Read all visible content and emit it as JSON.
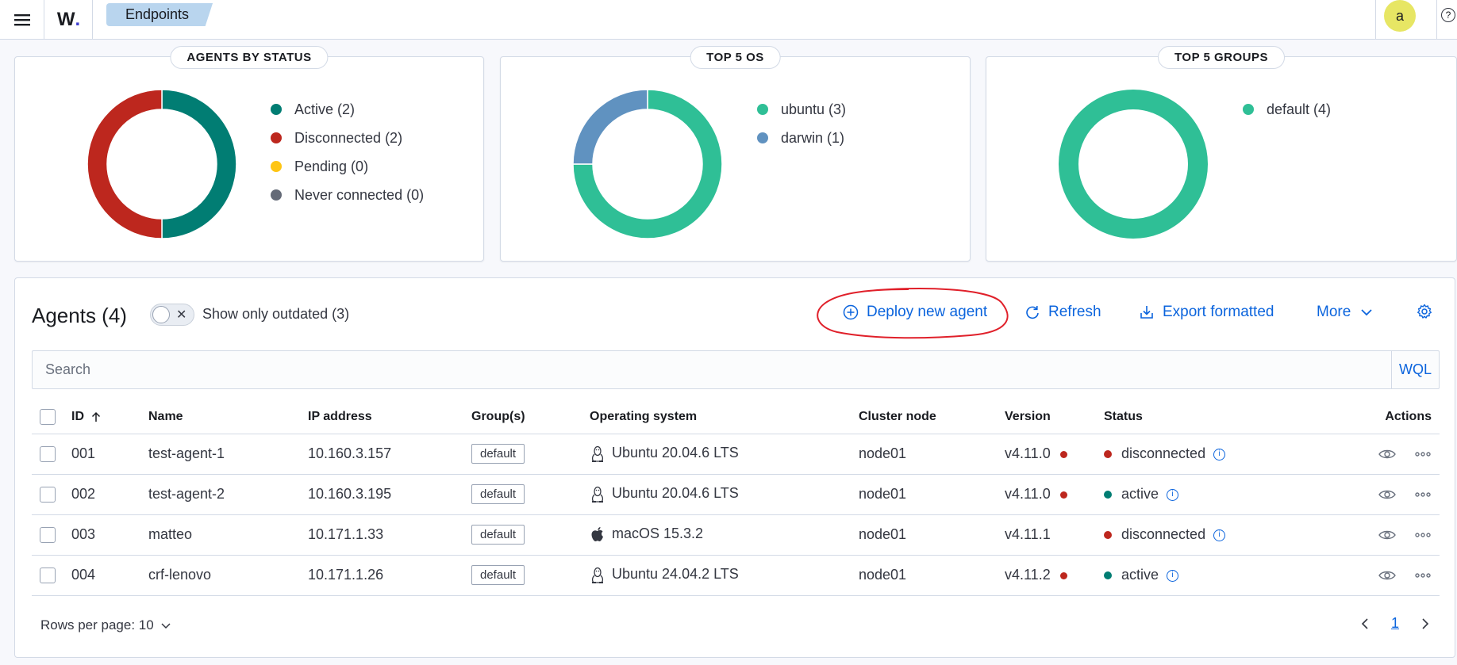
{
  "header": {
    "logo_text": "W",
    "logo_dot": ".",
    "breadcrumb": "Endpoints",
    "avatar_letter": "a",
    "help_symbol": "?"
  },
  "cards": {
    "status": {
      "title": "AGENTS BY STATUS",
      "legend": [
        {
          "label": "Active (2)",
          "color": "#017d73"
        },
        {
          "label": "Disconnected (2)",
          "color": "#bd271e"
        },
        {
          "label": "Pending (0)",
          "color": "#fec514"
        },
        {
          "label": "Never connected (0)",
          "color": "#646a77"
        }
      ],
      "chart_data": {
        "type": "pie",
        "categories": [
          "Active",
          "Disconnected",
          "Pending",
          "Never connected"
        ],
        "values": [
          2,
          2,
          0,
          0
        ]
      }
    },
    "os": {
      "title": "TOP 5 OS",
      "legend": [
        {
          "label": "ubuntu (3)",
          "color": "#2fbf96"
        },
        {
          "label": "darwin (1)",
          "color": "#6092c0"
        }
      ],
      "chart_data": {
        "type": "pie",
        "categories": [
          "ubuntu",
          "darwin"
        ],
        "values": [
          3,
          1
        ]
      }
    },
    "groups": {
      "title": "TOP 5 GROUPS",
      "legend": [
        {
          "label": "default (4)",
          "color": "#2fbf96"
        }
      ],
      "chart_data": {
        "type": "pie",
        "categories": [
          "default"
        ],
        "values": [
          4
        ]
      }
    }
  },
  "agents": {
    "title": "Agents (4)",
    "outdated_toggle_label": "Show only outdated (3)",
    "actions": {
      "deploy": "Deploy new agent",
      "refresh": "Refresh",
      "export": "Export formatted",
      "more": "More"
    },
    "search_placeholder": "Search",
    "wql_label": "WQL",
    "columns": [
      "ID",
      "Name",
      "IP address",
      "Group(s)",
      "Operating system",
      "Cluster node",
      "Version",
      "Status",
      "Actions"
    ],
    "rows": [
      {
        "id": "001",
        "name": "test-agent-1",
        "ip": "10.160.3.157",
        "group": "default",
        "os": "Ubuntu 20.04.6 LTS",
        "os_icon": "linux-icon",
        "node": "node01",
        "version": "v4.11.0",
        "outdated": true,
        "status": "disconnected",
        "status_color": "#bd271e"
      },
      {
        "id": "002",
        "name": "test-agent-2",
        "ip": "10.160.3.195",
        "group": "default",
        "os": "Ubuntu 20.04.6 LTS",
        "os_icon": "linux-icon",
        "node": "node01",
        "version": "v4.11.0",
        "outdated": true,
        "status": "active",
        "status_color": "#017d73"
      },
      {
        "id": "003",
        "name": "matteo",
        "ip": "10.171.1.33",
        "group": "default",
        "os": "macOS 15.3.2",
        "os_icon": "apple-icon",
        "node": "node01",
        "version": "v4.11.1",
        "outdated": false,
        "status": "disconnected",
        "status_color": "#bd271e"
      },
      {
        "id": "004",
        "name": "crf-lenovo",
        "ip": "10.171.1.26",
        "group": "default",
        "os": "Ubuntu 24.04.2 LTS",
        "os_icon": "linux-icon",
        "node": "node01",
        "version": "v4.11.2",
        "outdated": true,
        "status": "active",
        "status_color": "#017d73"
      }
    ],
    "rows_per_page": "Rows per page: 10",
    "current_page": "1"
  },
  "colors": {
    "accent": "#0b64dd",
    "annotation_circle": "#e0202a"
  }
}
